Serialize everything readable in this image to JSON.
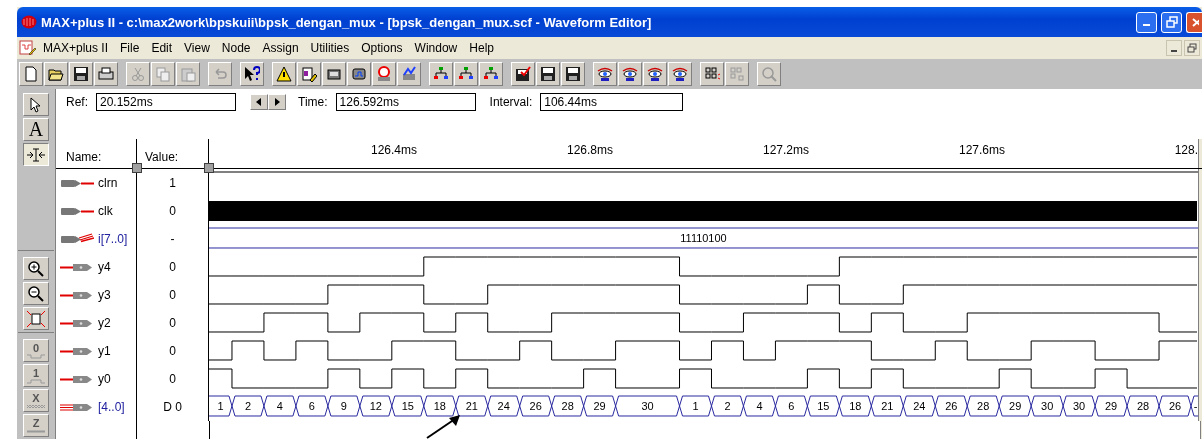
{
  "window": {
    "title": "MAX+plus II - c:\\max2work\\bpskuii\\bpsk_dengan_mux - [bpsk_dengan_mux.scf - Waveform Editor]"
  },
  "menu": [
    {
      "label": "MAX+plus II"
    },
    {
      "label": "File"
    },
    {
      "label": "Edit"
    },
    {
      "label": "View"
    },
    {
      "label": "Node"
    },
    {
      "label": "Assign"
    },
    {
      "label": "Utilities"
    },
    {
      "label": "Options"
    },
    {
      "label": "Window"
    },
    {
      "label": "Help"
    }
  ],
  "tools": {
    "text": "A",
    "low": "0",
    "high": "1",
    "unknown": "X",
    "high_z": "Z"
  },
  "ref_bar": {
    "ref_label": "Ref:",
    "ref": "20.152ms",
    "time_label": "Time:",
    "time": "126.592ms",
    "interval_label": "Interval:",
    "interval": "106.44ms"
  },
  "columns": {
    "name": "Name:",
    "value": "Value:"
  },
  "timeline": [
    "126.4ms",
    "126.8ms",
    "127.2ms",
    "127.6ms",
    "128."
  ],
  "signals": [
    {
      "kind": "input_constant",
      "name": "clrn",
      "value": "1"
    },
    {
      "kind": "input_clock",
      "name": "clk",
      "value": "0"
    },
    {
      "kind": "input_bus",
      "name": "i[7..0]",
      "value": "-",
      "bus": [
        "11110100"
      ]
    },
    {
      "kind": "output_bit",
      "name": "y4",
      "value": "0"
    },
    {
      "kind": "output_bit",
      "name": "y3",
      "value": "0"
    },
    {
      "kind": "output_bit",
      "name": "y2",
      "value": "0"
    },
    {
      "kind": "output_bit",
      "name": "y1",
      "value": "0"
    },
    {
      "kind": "output_bit",
      "name": "y0",
      "value": "0"
    },
    {
      "kind": "output_bus",
      "name": "[4..0]",
      "value": "D 0",
      "bus": [
        "1",
        "2",
        "4",
        "6",
        "9",
        "12",
        "15",
        "18",
        "21",
        "24",
        "26",
        "28",
        "29",
        "30",
        "1",
        "2",
        "4",
        "6",
        "15",
        "18",
        "21",
        "24",
        "26",
        "28",
        "29",
        "30",
        "30",
        "29",
        "28",
        "26",
        "-"
      ]
    }
  ]
}
